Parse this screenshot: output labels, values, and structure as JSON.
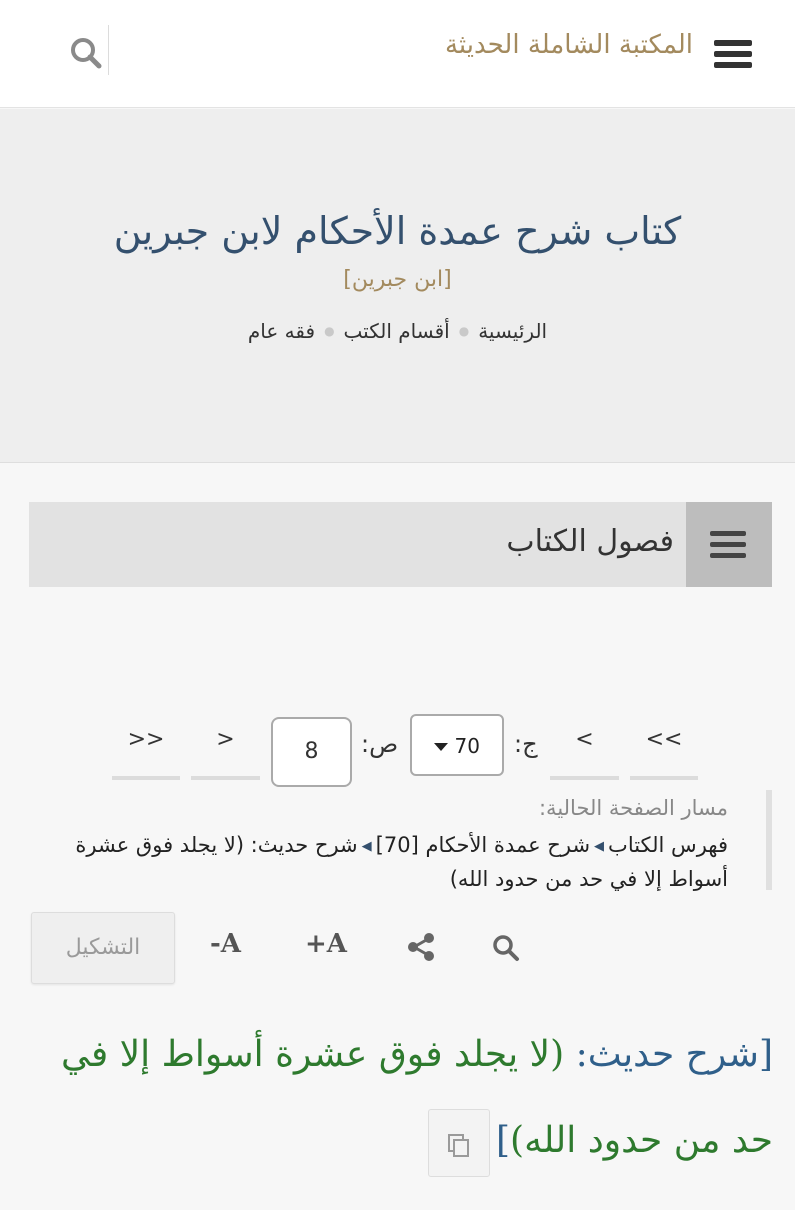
{
  "navbar": {
    "site_title": "المكتبة الشاملة الحديثة",
    "menu_icon": "hamburger-menu-icon",
    "search_icon": "search-icon"
  },
  "book": {
    "title": "كتاب شرح عمدة الأحكام لابن جبرين",
    "author": "[ابن جبرين]",
    "breadcrumb": [
      "الرئيسية",
      "أقسام الكتب",
      "فقه عام"
    ]
  },
  "chapters": {
    "label": "فصول الكتاب",
    "icon": "list-icon"
  },
  "pager": {
    "first": "<<",
    "prev": "<",
    "next": ">",
    "last": ">>",
    "volume_label": "ج:",
    "volume_value": "70",
    "page_label": "ص:",
    "page_value": "8"
  },
  "path": {
    "title": "مسار الصفحة الحالية:",
    "items": [
      "فهرس الكتاب",
      "شرح عمدة الأحكام [70]",
      "شرح حديث: (لا يجلد فوق عشرة أسواط إلا في حد من حدود الله)"
    ]
  },
  "toolbar": {
    "tashkeel": "التشكيل",
    "font_decrease": "-A",
    "font_increase": "+A",
    "share_icon": "share-icon",
    "search_icon": "search-icon"
  },
  "content": {
    "lead": "[شرح حديث: ",
    "hadith": "(لا يجلد فوق عشرة أسواط إلا في حد من حدود الله)",
    "close": "]",
    "copy_icon": "copy-icon"
  },
  "colors": {
    "brand_gold": "#a38a5e",
    "title_blue": "#34506e",
    "hadith_green": "#2e7a2e"
  }
}
